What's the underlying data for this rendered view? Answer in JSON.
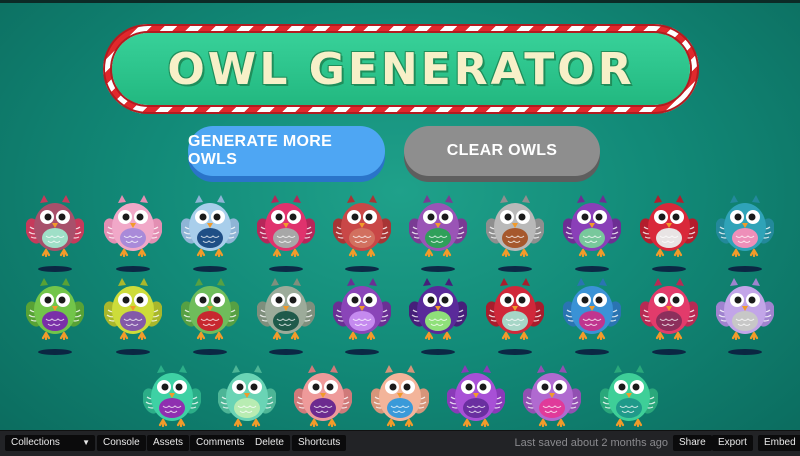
{
  "title": "OWL GENERATOR",
  "buttons": {
    "generate": "GENERATE MORE OWLS",
    "clear": "CLEAR OWLS"
  },
  "colors": {
    "background": "#128a78",
    "generate_button": "#4ea6f3",
    "clear_button": "#8e8e8e",
    "banner_stripe_red": "#e0282c",
    "banner_green": "#2cc48c"
  },
  "owls": [
    {
      "body": "#a8506b",
      "belly": "#9fdfc7",
      "accent": "#c63a5b"
    },
    {
      "body": "#f1a8c8",
      "belly": "#a98ad9",
      "accent": "#e38fb3"
    },
    {
      "body": "#a8ceeb",
      "belly": "#1f4f86",
      "accent": "#8fb5d6"
    },
    {
      "body": "#e0326d",
      "belly": "#a7a7a7",
      "accent": "#b62659"
    },
    {
      "body": "#c94747",
      "belly": "#d2705f",
      "accent": "#a73535"
    },
    {
      "body": "#9a54b6",
      "belly": "#2fa05a",
      "accent": "#7a3b94"
    },
    {
      "body": "#b9b9b9",
      "belly": "#a6582d",
      "accent": "#8f8f8f"
    },
    {
      "body": "#8a3fb8",
      "belly": "#78c89c",
      "accent": "#6d2e93"
    },
    {
      "body": "#d9283a",
      "belly": "#e8e4e4",
      "accent": "#b31d2d"
    },
    {
      "body": "#2fa3b8",
      "belly": "#ee8fb9",
      "accent": "#23899b"
    },
    {
      "body": "#72c54a",
      "belly": "#7a2fa8",
      "accent": "#58a235"
    },
    {
      "body": "#cddc3a",
      "belly": "#8359a9",
      "accent": "#a9b72b"
    },
    {
      "body": "#6fbd5b",
      "belly": "#c7282f",
      "accent": "#56a043"
    },
    {
      "body": "#9cab9a",
      "belly": "#1f5a4b",
      "accent": "#7f8f7d"
    },
    {
      "body": "#8a45b8",
      "belly": "#c58aef",
      "accent": "#6a2f94"
    },
    {
      "body": "#5a2a9a",
      "belly": "#8fe07a",
      "accent": "#461f7a"
    },
    {
      "body": "#d0283a",
      "belly": "#a6d6c7",
      "accent": "#a81d2d"
    },
    {
      "body": "#3a92d6",
      "belly": "#c0358f",
      "accent": "#2a74b2"
    },
    {
      "body": "#e23b6b",
      "belly": "#8c2f5c",
      "accent": "#b82a54"
    },
    {
      "body": "#c2a5e8",
      "belly": "#c7c7c7",
      "accent": "#a083cf"
    },
    {
      "body": "#3ed1a4",
      "belly": "#8f2fb0",
      "accent": "#2cae88"
    },
    {
      "body": "#6ad4b5",
      "belly": "#b8ecb2",
      "accent": "#4db596"
    },
    {
      "body": "#ee9a9a",
      "belly": "#6c2a8f",
      "accent": "#d07a7a"
    },
    {
      "body": "#f3b49a",
      "belly": "#3a9ad9",
      "accent": "#d6957a"
    },
    {
      "body": "#a850d6",
      "belly": "#6a2fa0",
      "accent": "#8a3ab8"
    },
    {
      "body": "#b06ad0",
      "belly": "#e03a9a",
      "accent": "#9250b2"
    },
    {
      "body": "#3ecf98",
      "belly": "#1f9a8a",
      "accent": "#2aa87b"
    }
  ],
  "bottom_bar": {
    "collections": "Collections",
    "console": "Console",
    "assets": "Assets",
    "comments": "Comments",
    "delete": "Delete",
    "shortcuts": "Shortcuts",
    "status": "Last saved about 2 months ago",
    "share": "Share",
    "export": "Export",
    "embed": "Embed"
  }
}
